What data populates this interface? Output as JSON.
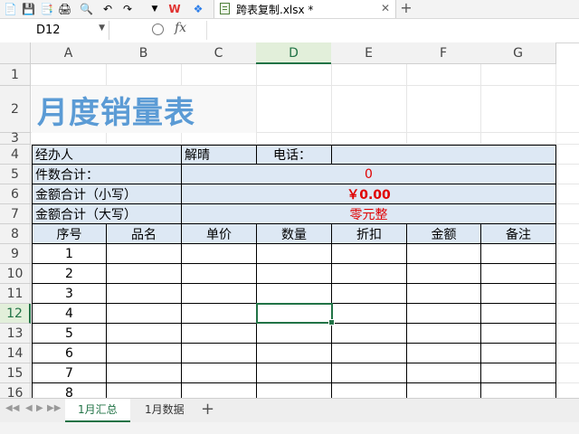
{
  "toolbar": {
    "brand_label": "W",
    "file_tab": {
      "name": "跨表复制.xlsx *"
    }
  },
  "formula_bar": {
    "cell_ref": "D12",
    "fx_label": "fx",
    "formula": ""
  },
  "columns": [
    "A",
    "B",
    "C",
    "D",
    "E",
    "F",
    "G"
  ],
  "active_column": "D",
  "rows": [
    "1",
    "2",
    "3",
    "4",
    "5",
    "6",
    "7",
    "8",
    "9",
    "10",
    "11",
    "12",
    "13",
    "14",
    "15",
    "16"
  ],
  "active_row": "12",
  "sheet": {
    "title": "月度销量表",
    "agent_label": "经办人",
    "agent_value": "解晴",
    "phone_label": "电话：",
    "phone_value": "",
    "count_label": "件数合计：",
    "count_value": "0",
    "amount_small_label": "金额合计（小写）",
    "amount_small_value": "￥0.00",
    "amount_big_label": "金额合计（大写）",
    "amount_big_value": "零元整",
    "headers": [
      "序号",
      "品名",
      "单价",
      "数量",
      "折扣",
      "金额",
      "备注"
    ],
    "serials": [
      "1",
      "2",
      "3",
      "4",
      "5",
      "6",
      "7",
      "8"
    ]
  },
  "sheet_tabs": [
    {
      "label": "1月汇总",
      "active": true
    },
    {
      "label": "1月数据",
      "active": false
    }
  ]
}
